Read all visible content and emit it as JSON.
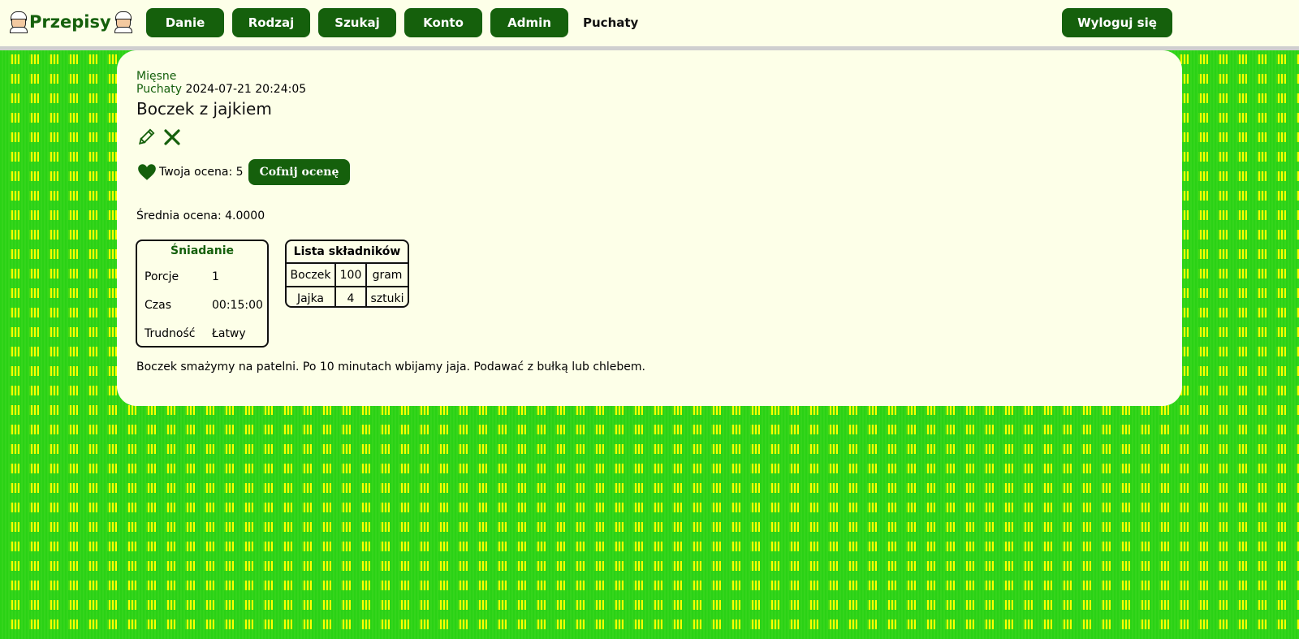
{
  "header": {
    "logo_text": "Przepisy",
    "nav": [
      {
        "label": "Danie"
      },
      {
        "label": "Rodzaj"
      },
      {
        "label": "Szukaj"
      },
      {
        "label": "Konto"
      },
      {
        "label": "Admin"
      }
    ],
    "username": "Puchaty",
    "logout_label": "Wyloguj się"
  },
  "recipe": {
    "category": "Mięsne",
    "author": "Puchaty",
    "date": "2024-07-21 20:24:05",
    "title": "Boczek z jajkiem",
    "your_rating_text": "Twoja ocena: 5",
    "undo_rating_label": "Cofnij ocenę",
    "average_text": "Średnia ocena: 4.0000",
    "meal_type": "Śniadanie",
    "meta": [
      {
        "key": "Porcje",
        "value": "1"
      },
      {
        "key": "Czas",
        "value": "00:15:00"
      },
      {
        "key": "Trudność",
        "value": "Łatwy"
      }
    ],
    "ingredients_title": "Lista składników",
    "ingredients": [
      {
        "name": "Boczek",
        "amount": "100",
        "unit": "gram"
      },
      {
        "name": "Jajka",
        "amount": "4",
        "unit": "sztuki"
      }
    ],
    "description": "Boczek smażymy na patelni. Po 10 minutach wbijamy jaja. Podawać z bułką lub chlebem."
  },
  "colors": {
    "accent": "#15600c",
    "card_bg": "#fdffe8",
    "bg_yellow": "#ffff00",
    "bg_green": "#35d51c"
  },
  "icons": {
    "edit": "pencil-icon",
    "delete": "close-icon",
    "rating": "heart-icon",
    "logo": "chef-icon"
  }
}
